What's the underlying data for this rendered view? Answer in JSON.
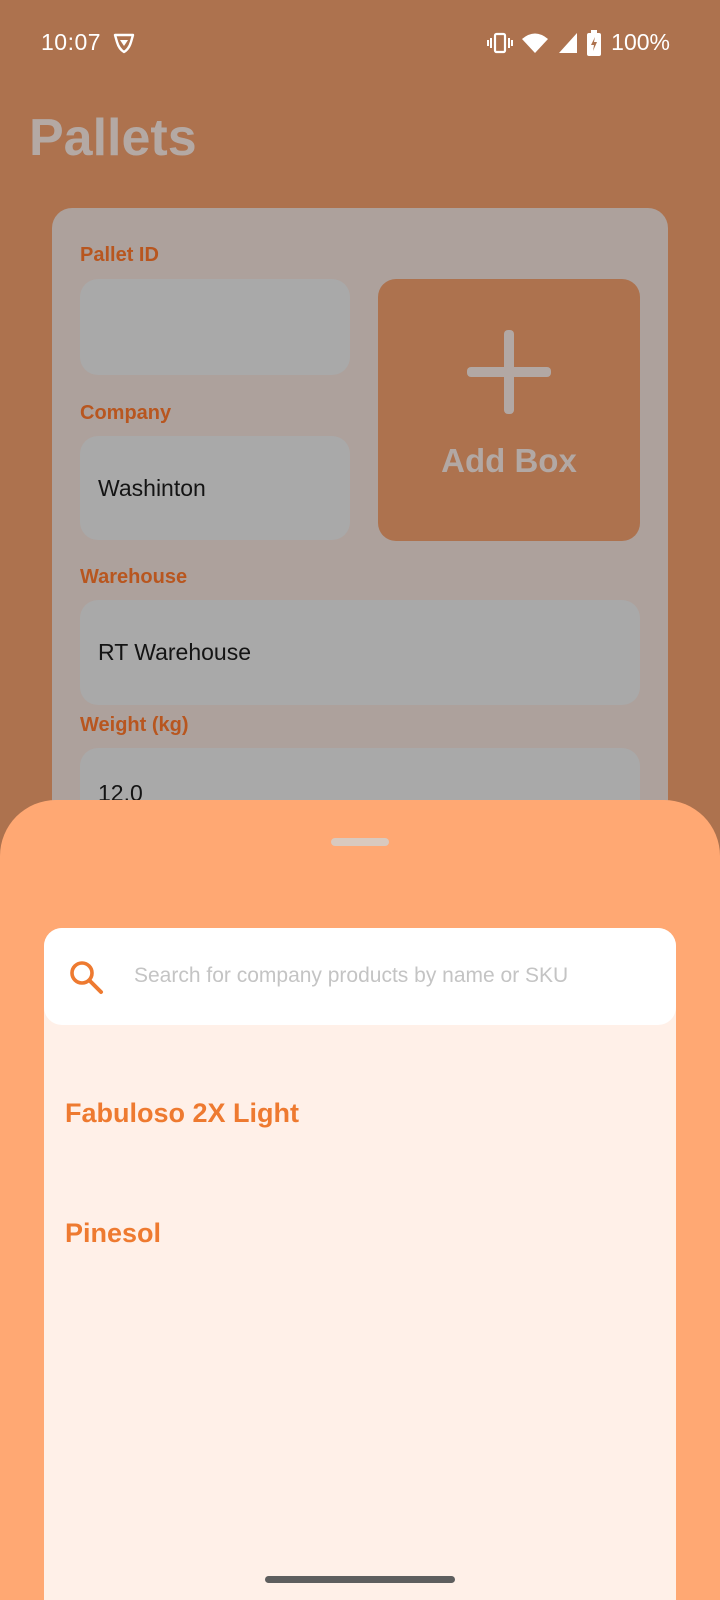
{
  "status_bar": {
    "time": "10:07",
    "battery": "100%",
    "icons": [
      "vpn-shield-icon",
      "vibrate-icon",
      "wifi-icon",
      "signal-icon",
      "battery-charging-icon"
    ]
  },
  "page": {
    "title": "Pallets"
  },
  "form": {
    "pallet_id_label": "Pallet ID",
    "pallet_id_value": "",
    "company_label": "Company",
    "company_value": "Washinton",
    "warehouse_label": "Warehouse",
    "warehouse_value": "RT Warehouse",
    "weight_label": "Weight (kg)",
    "weight_value": "12.0",
    "add_box_label": "Add Box"
  },
  "bottom_sheet": {
    "search_placeholder": "Search for company products by name or SKU",
    "search_value": "",
    "products": [
      "Fabuloso 2X Light",
      "Pinesol"
    ]
  },
  "colors": {
    "accent": "#EE7A30",
    "sheet_background": "#FFA873",
    "panel_background": "#FFF0E8",
    "scrim_brown": "#AD724E",
    "label_orange": "#B8561F"
  }
}
